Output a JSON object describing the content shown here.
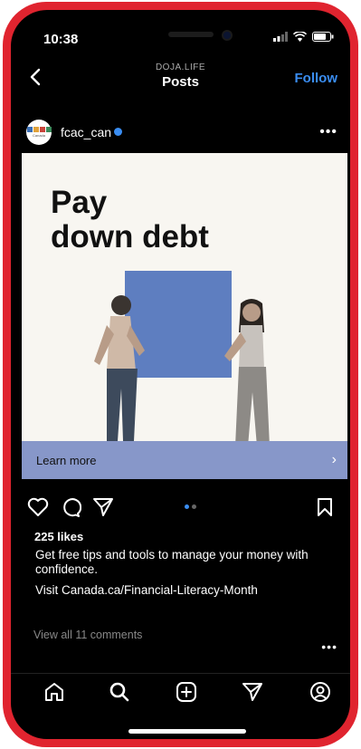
{
  "status": {
    "time": "10:38"
  },
  "header": {
    "subtitle": "DOJA.LIFE",
    "title": "Posts",
    "follow_label": "Follow"
  },
  "post": {
    "username": "fcac_can",
    "avatar_text": "Canada",
    "headline_line1": "Pay",
    "headline_line2": "down debt",
    "cta_label": "Learn more",
    "likes": "225 likes",
    "caption": "Get free tips and tools to manage your money with confidence.",
    "visit": "Visit Canada.ca/Financial-Literacy-Month",
    "view_comments": "View all 11 comments",
    "carousel": {
      "total": 2,
      "active": 1
    }
  },
  "tabbar": {
    "items": [
      "home-icon",
      "search-icon",
      "create-icon",
      "messages-icon",
      "profile-icon"
    ]
  },
  "colors": {
    "frame": "#e0242f",
    "accent": "#3a8df2",
    "box": "#5e7ec0",
    "cta_bar": "#8797c9",
    "image_bg": "#f8f6f1"
  }
}
